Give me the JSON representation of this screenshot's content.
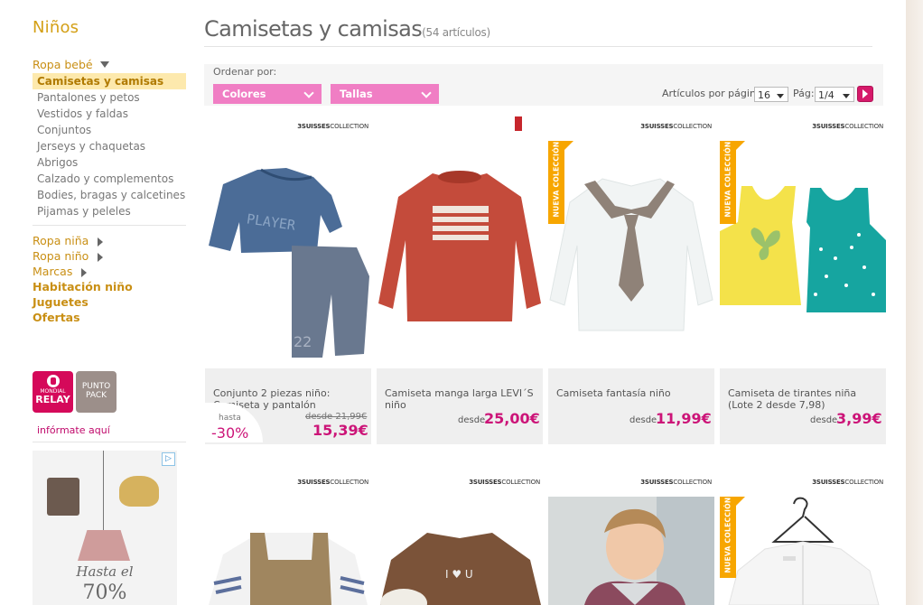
{
  "sidebar": {
    "title": "Niños",
    "group": "Ropa bebé",
    "sub_items": [
      {
        "label": "Camisetas y camisas",
        "active": true
      },
      {
        "label": "Pantalones y petos"
      },
      {
        "label": "Vestidos y faldas"
      },
      {
        "label": "Conjuntos"
      },
      {
        "label": "Jerseys y chaquetas"
      },
      {
        "label": "Abrigos"
      },
      {
        "label": "Calzado y complementos"
      },
      {
        "label": "Bodies, bragas y calcetines"
      },
      {
        "label": "Pijamas y peleles"
      }
    ],
    "categories": [
      {
        "label": "Ropa niña"
      },
      {
        "label": "Ropa niño"
      },
      {
        "label": "Marcas"
      },
      {
        "label": "Habitación niño"
      },
      {
        "label": "Juguetes"
      },
      {
        "label": "Ofertas"
      }
    ],
    "relay": {
      "mondial": "MONDIAL",
      "relay": "RELAY",
      "punto": "PUNTO",
      "pack": "PACK"
    },
    "info_link": "infórmate aquí",
    "ad": {
      "line1": "Hasta el",
      "line2": "70%",
      "badge": "▷"
    }
  },
  "header": {
    "title": "Camisetas y camisas",
    "count": "(54 artículos)"
  },
  "filters": {
    "order_label": "Ordenar por:",
    "colors": "Colores",
    "sizes": "Tallas",
    "per_page_label": "Artículos por página:",
    "per_page_value": "16",
    "page_label": "Pág:",
    "page_value": "1/4"
  },
  "brand_label": {
    "main": "3SUISSES",
    "rest": "COLLECTION"
  },
  "nueva_label": "NUEVA COLECCIÓN",
  "products": [
    {
      "name": "Conjunto 2 piezas niño: Camiseta y pantalón",
      "old_price": "desde 21,99€",
      "price": "15,39€",
      "discount_label": "hasta",
      "discount": "-30%"
    },
    {
      "name": "Camiseta manga larga LEVI´S niño",
      "desde": "desde",
      "price": "25,00€"
    },
    {
      "name": "Camiseta fantasía niño",
      "desde": "desde",
      "price": "11,99€"
    },
    {
      "name": "Camiseta de tirantes niña (Lote 2 desde 7,98)",
      "desde": "desde",
      "price": "3,99€"
    }
  ],
  "colors": {
    "accent": "#d4a017",
    "price": "#cc1478",
    "pill": "#f07ec4",
    "nueva": "#f7a600",
    "active_bg": "#fde9ad"
  }
}
